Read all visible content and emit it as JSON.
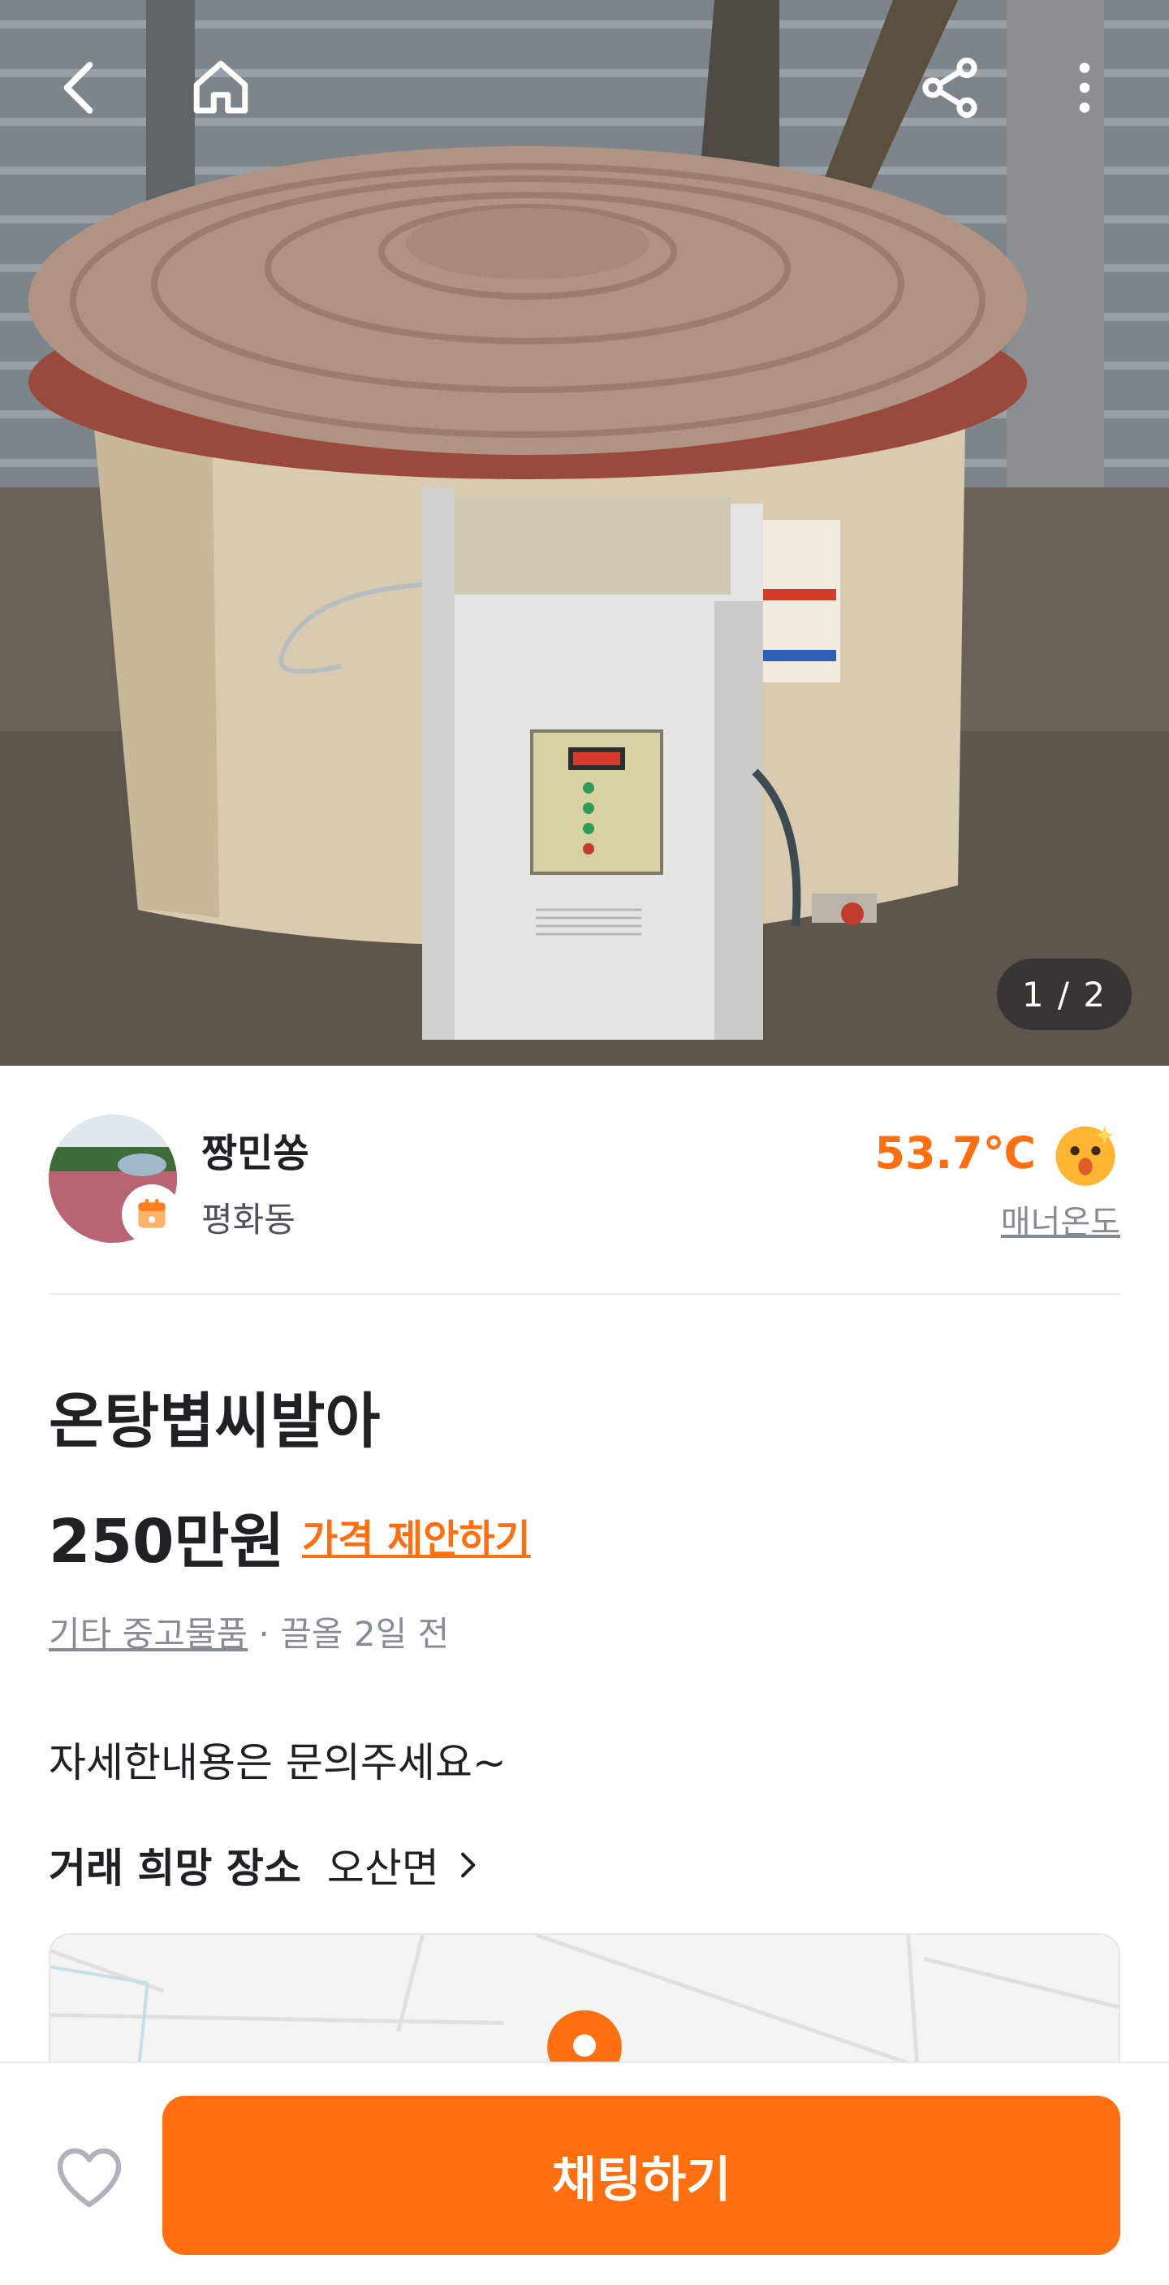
{
  "hero": {
    "image_label": "전기 볍씨 발아기 사진",
    "counter": "1 / 2",
    "icons": {
      "back": "chevron-left-icon",
      "home": "home-icon",
      "share": "share-icon",
      "more": "more-vertical-icon"
    }
  },
  "seller": {
    "name": "짱민쏭",
    "location": "평화동",
    "temperature": "53.7℃",
    "temperature_label": "매너온도",
    "temperature_icon": "smiling-face-icon"
  },
  "product": {
    "title": "온탕볍씨발아",
    "price": "250만원",
    "offer_link": "가격 제안하기",
    "category": "기타 중고물품",
    "meta_separator": " · ",
    "posted": "끌올 2일 전",
    "description": "자세한내용은 문의주세요~"
  },
  "trade": {
    "label": "거래 희망 장소",
    "place": "오산면"
  },
  "bottom": {
    "chat_button": "채팅하기",
    "like_icon": "heart-outline-icon"
  },
  "colors": {
    "accent": "#ff6f0f",
    "text": "#212124",
    "subtext": "#868b94"
  }
}
